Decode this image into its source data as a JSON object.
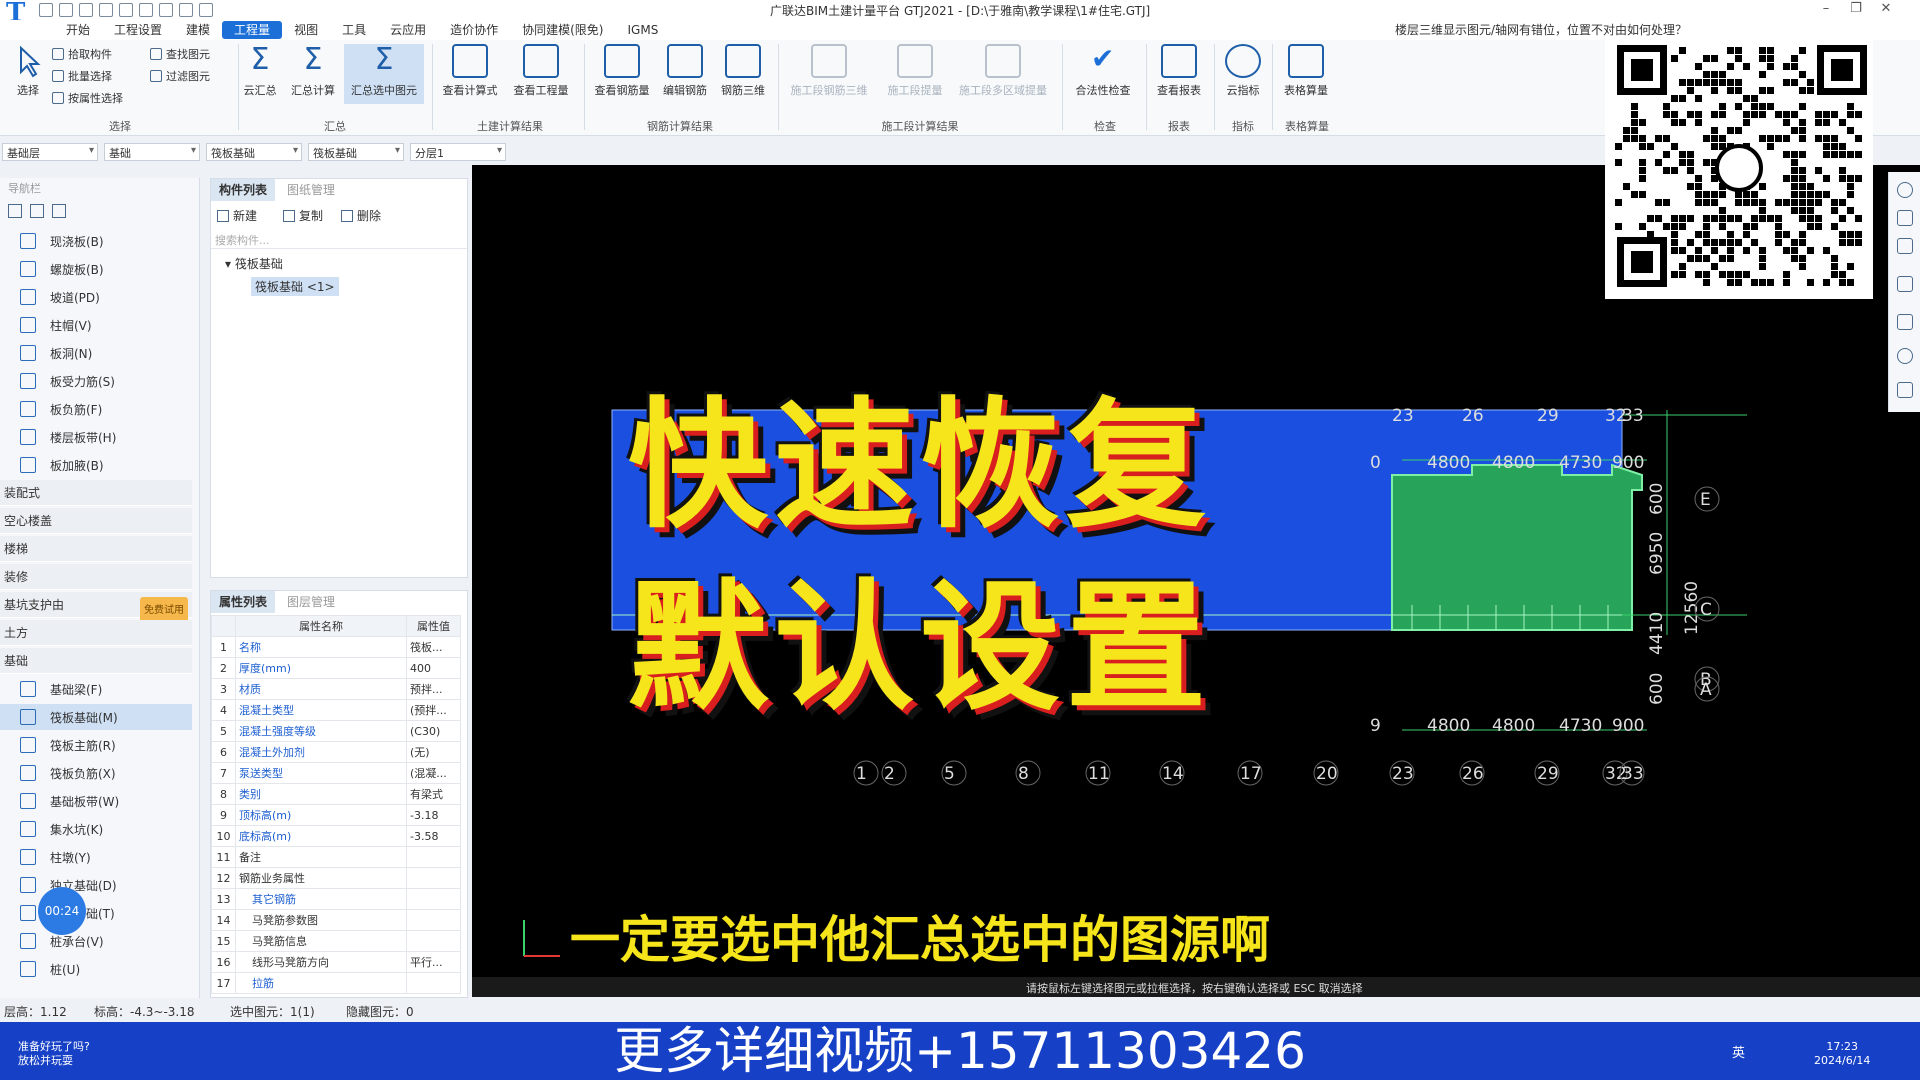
{
  "window": {
    "title": "广联达BIM土建计量平台 GTJ2021 - [D:\\于雅南\\教学课程\\1#住宅.GTJ]"
  },
  "menus": [
    "开始",
    "工程设置",
    "建模",
    "工程量",
    "视图",
    "工具",
    "云应用",
    "造价协作",
    "协同建模(限免)",
    "IGMS"
  ],
  "active_menu": "工程量",
  "notice": "楼层三维显示图元/轴网有错位，位置不对由如何处理？",
  "ribbon": {
    "select_big": "选择",
    "pick_component": "拾取构件",
    "batch_select": "批量选择",
    "attr_select": "按属性选择",
    "find_element": "查找图元",
    "filter_element": "过滤图元",
    "cloud_summary": "云汇总",
    "summary_calc": "汇总计算",
    "summary_selected": "汇总选中图元",
    "view_formula": "查看计算式",
    "view_quantity": "查看工程量",
    "view_rebar": "查看钢筋量",
    "edit_rebar": "编辑钢筋",
    "rebar_3d": "钢筋三维",
    "stage_rebar_3d": "施工段钢筋三维",
    "stage_quantity": "施工段提量",
    "stage_multi": "施工段多区域提量",
    "legality_check": "合法性检查",
    "view_report": "查看报表",
    "cloud_index": "云指标",
    "table_calc": "表格算量",
    "groups": {
      "select": "选择",
      "summary": "汇总",
      "civil": "土建计算结果",
      "rebar": "钢筋计算结果",
      "stage": "施工段计算结果",
      "check": "检查",
      "report": "报表",
      "index": "指标",
      "table": "表格算量"
    }
  },
  "selectors": [
    "基础层",
    "基础",
    "筏板基础",
    "筏板基础",
    "分层1"
  ],
  "nav": {
    "header": "导航栏",
    "items_top": [
      "现浇板(B)",
      "螺旋板(B)",
      "坡道(PD)",
      "柱帽(V)",
      "板洞(N)",
      "板受力筋(S)",
      "板负筋(F)",
      "楼层板带(H)",
      "板加腋(B)"
    ],
    "cats": [
      "装配式",
      "空心楼盖",
      "楼梯",
      "装修",
      "基坑支护由",
      "土方",
      "基础"
    ],
    "trial_badge": "免费试用",
    "items_base": [
      "基础梁(F)",
      "筏板基础(M)",
      "筏板主筋(R)",
      "筏板负筋(X)",
      "基础板带(W)",
      "集水坑(K)",
      "柱墩(Y)",
      "独立基础(D)",
      "条形基础(T)",
      "桩承台(V)",
      "桩(U)"
    ],
    "selected": "筏板基础(M)"
  },
  "timer": "00:24",
  "comp": {
    "tabs": [
      "构件列表",
      "图纸管理"
    ],
    "new": "新建",
    "copy": "复制",
    "delete": "删除",
    "search_ph": "搜索构件...",
    "tree_parent": "筏板基础",
    "tree_child": "筏板基础 <1>"
  },
  "props": {
    "tabs": [
      "属性列表",
      "图层管理"
    ],
    "col_name": "属性名称",
    "col_value": "属性值",
    "rows": [
      [
        "1",
        "名称",
        "筏板..."
      ],
      [
        "2",
        "厚度(mm)",
        "400"
      ],
      [
        "3",
        "材质",
        "预拌..."
      ],
      [
        "4",
        "混凝土类型",
        "(预拌..."
      ],
      [
        "5",
        "混凝土强度等级",
        "(C30)"
      ],
      [
        "6",
        "混凝土外加剂",
        "(无)"
      ],
      [
        "7",
        "泵送类型",
        "(混凝..."
      ],
      [
        "8",
        "类别",
        "有梁式"
      ],
      [
        "9",
        "顶标高(m)",
        "-3.18"
      ],
      [
        "10",
        "底标高(m)",
        "-3.58"
      ],
      [
        "11",
        "备注",
        ""
      ],
      [
        "12",
        "钢筋业务属性",
        ""
      ],
      [
        "13",
        "其它钢筋",
        ""
      ],
      [
        "14",
        "马凳筋参数图",
        ""
      ],
      [
        "15",
        "马凳筋信息",
        ""
      ],
      [
        "16",
        "线形马凳筋方向",
        "平行..."
      ],
      [
        "17",
        "拉筋",
        ""
      ]
    ]
  },
  "cad": {
    "top_axis": [
      "23",
      "26",
      "29",
      "32",
      "33"
    ],
    "bottom_axis": [
      "1",
      "2",
      "5",
      "8",
      "11",
      "14",
      "17",
      "20",
      "23",
      "26",
      "29",
      "32",
      "33"
    ],
    "dims_top": [
      "0",
      "4800",
      "4800",
      "4730",
      "900"
    ],
    "dims_bottom": [
      "9",
      "4800",
      "4800",
      "4730",
      "900"
    ],
    "dims_right": [
      "600",
      "6950",
      "12560",
      "600",
      "4410"
    ],
    "axis_letters": [
      "E",
      "C",
      "B",
      "A"
    ],
    "left_dims": [
      "600"
    ],
    "status_hint": "请按鼠标左键选择图元或拉框选择，按右键确认选择或 ESC 取消选择"
  },
  "big_title_line1": "快速恢复",
  "big_title_line2": "默认设置",
  "subtitle": "一定要选中他汇总选中的图源啊",
  "statusbar": {
    "floor_height": "层高：1.12",
    "elevation": "标高：-4.3~-3.18",
    "selected": "选中图元：1(1)",
    "hidden": "隐藏图元：0"
  },
  "banner": "更多详细视频+15711303426",
  "taskbar": {
    "msg1": "准备好玩了吗?",
    "msg2": "放松并玩耍",
    "lang": "英",
    "time": "17:23",
    "date": "2024/6/14"
  },
  "colors": {
    "accent": "#1d6fd8",
    "slab_green": "#27a35a",
    "slab_blue": "#1a4fe0",
    "banner": "#1640c6",
    "title_yellow": "#f7e51b"
  }
}
